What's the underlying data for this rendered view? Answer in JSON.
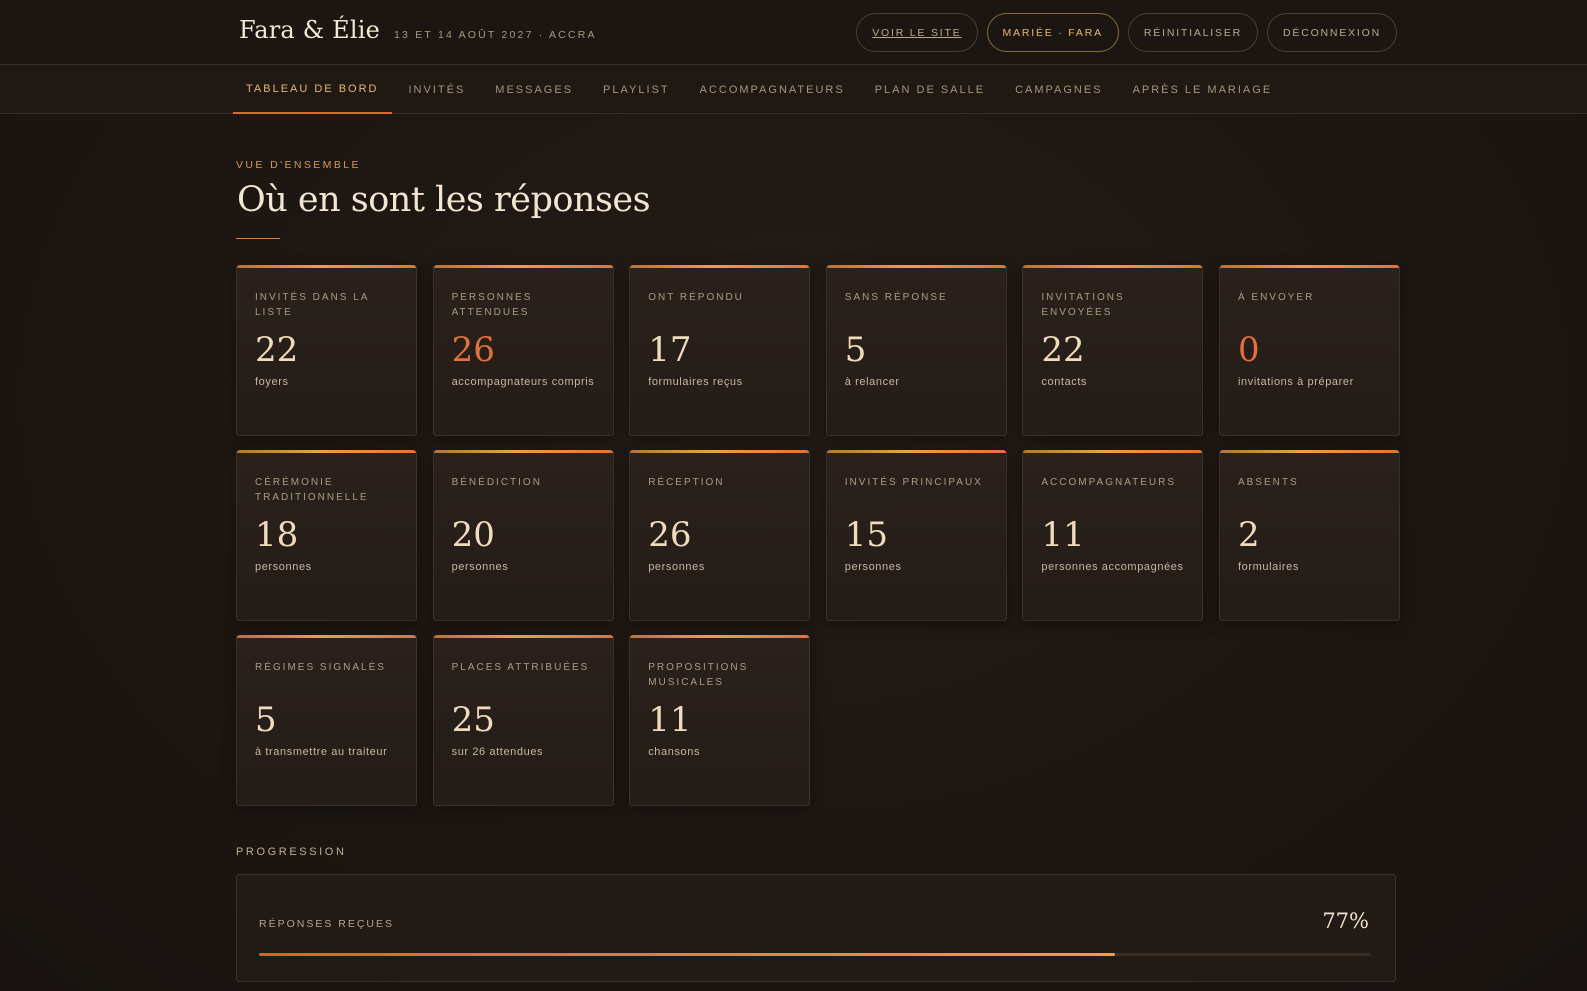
{
  "header": {
    "brand": "Fara & Élie",
    "date_location": "13 ET 14 AOÛT 2027 · ACCRA",
    "actions": [
      {
        "label": "VOIR LE SITE"
      },
      {
        "label": "MARIÉE · FARA"
      },
      {
        "label": "RÉINITIALISER"
      },
      {
        "label": "DÉCONNEXION"
      }
    ]
  },
  "nav": {
    "tabs": [
      {
        "label": "TABLEAU DE BORD"
      },
      {
        "label": "INVITÉS"
      },
      {
        "label": "MESSAGES"
      },
      {
        "label": "PLAYLIST"
      },
      {
        "label": "ACCOMPAGNATEURS"
      },
      {
        "label": "PLAN DE SALLE"
      },
      {
        "label": "CAMPAGNES"
      },
      {
        "label": "APRÈS LE MARIAGE"
      }
    ]
  },
  "overview": {
    "eyebrow": "VUE D'ENSEMBLE",
    "title": "Où en sont les réponses"
  },
  "cards": [
    {
      "label": "Invités dans la liste",
      "value": "22",
      "sub": "foyers"
    },
    {
      "label": "Personnes attendues",
      "value": "26",
      "sub": "accompagnateurs compris"
    },
    {
      "label": "Ont répondu",
      "value": "17",
      "sub": "formulaires reçus"
    },
    {
      "label": "Sans réponse",
      "value": "5",
      "sub": "à relancer"
    },
    {
      "label": "Invitations envoyées",
      "value": "22",
      "sub": "contacts"
    },
    {
      "label": "À envoyer",
      "value": "0",
      "sub": "invitations à préparer"
    },
    {
      "label": "Cérémonie traditionnelle",
      "value": "18",
      "sub": "personnes"
    },
    {
      "label": "Bénédiction",
      "value": "20",
      "sub": "personnes"
    },
    {
      "label": "Réception",
      "value": "26",
      "sub": "personnes"
    },
    {
      "label": "Invités principaux",
      "value": "15",
      "sub": "personnes"
    },
    {
      "label": "Accompagnateurs",
      "value": "11",
      "sub": "personnes accompagnées"
    },
    {
      "label": "Absents",
      "value": "2",
      "sub": "formulaires"
    },
    {
      "label": "Régimes signalés",
      "value": "5",
      "sub": "à transmettre au traiteur"
    },
    {
      "label": "Places attribuées",
      "value": "25",
      "sub": "sur 26 attendues"
    },
    {
      "label": "Propositions musicales",
      "value": "11",
      "sub": "chansons"
    }
  ],
  "progress": {
    "eyebrow": "PROGRESSION",
    "label": "RÉPONSES REÇUES",
    "percent_text": "77%",
    "fraction": 0.77
  },
  "colors": {
    "accent": "#e0713c",
    "gold": "#e6a24a",
    "background": "#1c1612"
  }
}
